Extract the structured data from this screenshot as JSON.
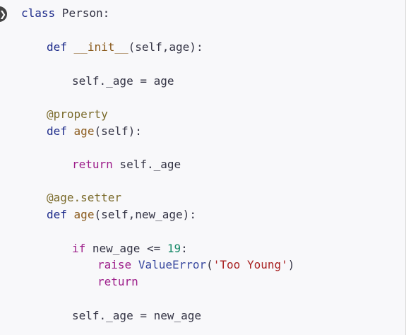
{
  "editor": {
    "copy_button_label": "❯",
    "lines": [
      {
        "tokens": [
          {
            "t": "class",
            "c": "kw"
          },
          {
            "t": " Person:",
            "c": ""
          }
        ]
      },
      {
        "tokens": [
          {
            "t": "def",
            "c": "kw"
          },
          {
            "t": " ",
            "c": ""
          },
          {
            "t": "__init__",
            "c": "fn"
          },
          {
            "t": "(self,age):",
            "c": ""
          }
        ]
      },
      {
        "tokens": [
          {
            "t": "self._age = age",
            "c": ""
          }
        ]
      },
      {
        "tokens": [
          {
            "t": "@property",
            "c": "dec"
          }
        ]
      },
      {
        "tokens": [
          {
            "t": "def",
            "c": "kw"
          },
          {
            "t": " ",
            "c": ""
          },
          {
            "t": "age",
            "c": "fn"
          },
          {
            "t": "(self):",
            "c": ""
          }
        ]
      },
      {
        "tokens": [
          {
            "t": "return",
            "c": "kw-ctl"
          },
          {
            "t": " self._age",
            "c": ""
          }
        ]
      },
      {
        "tokens": [
          {
            "t": "@age.setter",
            "c": "dec"
          }
        ]
      },
      {
        "tokens": [
          {
            "t": "def",
            "c": "kw"
          },
          {
            "t": " ",
            "c": ""
          },
          {
            "t": "age",
            "c": "fn"
          },
          {
            "t": "(self,new_age):",
            "c": ""
          }
        ]
      },
      {
        "tokens": [
          {
            "t": "if",
            "c": "kw-ctl"
          },
          {
            "t": " new_age <= ",
            "c": ""
          },
          {
            "t": "19",
            "c": "num"
          },
          {
            "t": ":",
            "c": ""
          }
        ]
      },
      {
        "tokens": [
          {
            "t": "raise",
            "c": "kw-ctl"
          },
          {
            "t": " ",
            "c": ""
          },
          {
            "t": "ValueError",
            "c": "builtin"
          },
          {
            "t": "(",
            "c": ""
          },
          {
            "t": "'Too Young'",
            "c": "str"
          },
          {
            "t": ")",
            "c": ""
          }
        ]
      },
      {
        "tokens": [
          {
            "t": "return",
            "c": "kw-ctl"
          }
        ]
      },
      {
        "tokens": [
          {
            "t": "self._age = new_age",
            "c": ""
          }
        ]
      }
    ]
  }
}
